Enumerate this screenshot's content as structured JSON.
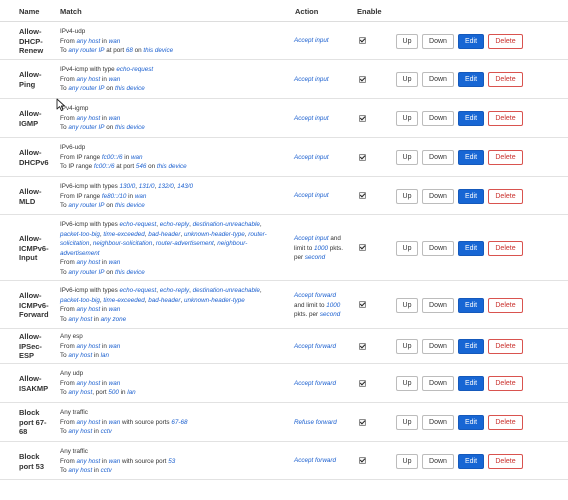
{
  "header": {
    "name": "Name",
    "match": "Match",
    "action": "Action",
    "enable": "Enable"
  },
  "buttons": {
    "up": "Up",
    "down": "Down",
    "edit": "Edit",
    "delete": "Delete"
  },
  "rules": [
    {
      "name": [
        "Allow-",
        "DHCP-",
        "Renew"
      ],
      "match": [
        [
          {
            "t": "IPv4-udp"
          }
        ],
        [
          {
            "t": "From "
          },
          {
            "t": "any host",
            "h": true
          },
          {
            "t": " in "
          },
          {
            "t": "wan",
            "h": true
          }
        ],
        [
          {
            "t": "To "
          },
          {
            "t": "any router IP",
            "h": true
          },
          {
            "t": " at port "
          },
          {
            "t": "68",
            "h": true
          },
          {
            "t": " on "
          },
          {
            "t": "this device",
            "h": true
          }
        ]
      ],
      "action": [
        [
          {
            "t": "Accept input",
            "h": true
          }
        ]
      ],
      "enabled": true
    },
    {
      "name": [
        "Allow-",
        "Ping"
      ],
      "match": [
        [
          {
            "t": "IPv4-icmp with type "
          },
          {
            "t": "echo-request",
            "h": true
          }
        ],
        [
          {
            "t": "From "
          },
          {
            "t": "any host",
            "h": true
          },
          {
            "t": " in "
          },
          {
            "t": "wan",
            "h": true
          }
        ],
        [
          {
            "t": "To "
          },
          {
            "t": "any router IP",
            "h": true
          },
          {
            "t": " on "
          },
          {
            "t": "this device",
            "h": true
          }
        ]
      ],
      "action": [
        [
          {
            "t": "Accept input",
            "h": true
          }
        ]
      ],
      "enabled": true
    },
    {
      "name": [
        "Allow-",
        "IGMP"
      ],
      "match": [
        [
          {
            "t": "IPv4-igmp"
          }
        ],
        [
          {
            "t": "From "
          },
          {
            "t": "any host",
            "h": true
          },
          {
            "t": " in "
          },
          {
            "t": "wan",
            "h": true
          }
        ],
        [
          {
            "t": "To "
          },
          {
            "t": "any router IP",
            "h": true
          },
          {
            "t": " on "
          },
          {
            "t": "this device",
            "h": true
          }
        ]
      ],
      "action": [
        [
          {
            "t": "Accept input",
            "h": true
          }
        ]
      ],
      "enabled": true
    },
    {
      "name": [
        "Allow-",
        "DHCPv6"
      ],
      "match": [
        [
          {
            "t": "IPv6-udp"
          }
        ],
        [
          {
            "t": "From IP range "
          },
          {
            "t": "fc00::/6",
            "h": true
          },
          {
            "t": " in "
          },
          {
            "t": "wan",
            "h": true
          }
        ],
        [
          {
            "t": "To IP range "
          },
          {
            "t": "fc00::/6",
            "h": true
          },
          {
            "t": " at port "
          },
          {
            "t": "546",
            "h": true
          },
          {
            "t": " on "
          },
          {
            "t": "this device",
            "h": true
          }
        ]
      ],
      "action": [
        [
          {
            "t": "Accept input",
            "h": true
          }
        ]
      ],
      "enabled": true
    },
    {
      "name": [
        "Allow-",
        "MLD"
      ],
      "match": [
        [
          {
            "t": "IPv6-icmp with types "
          },
          {
            "t": "130/0",
            "h": true
          },
          {
            "t": ", "
          },
          {
            "t": "131/0",
            "h": true
          },
          {
            "t": ", "
          },
          {
            "t": "132/0",
            "h": true
          },
          {
            "t": ", "
          },
          {
            "t": "143/0",
            "h": true
          }
        ],
        [
          {
            "t": "From IP range "
          },
          {
            "t": "fe80::/10",
            "h": true
          },
          {
            "t": " in "
          },
          {
            "t": "wan",
            "h": true
          }
        ],
        [
          {
            "t": "To "
          },
          {
            "t": "any router IP",
            "h": true
          },
          {
            "t": " on "
          },
          {
            "t": "this device",
            "h": true
          }
        ]
      ],
      "action": [
        [
          {
            "t": "Accept input",
            "h": true
          }
        ]
      ],
      "enabled": true
    },
    {
      "name": [
        "Allow-",
        "ICMPv6-",
        "Input"
      ],
      "match": [
        [
          {
            "t": "IPv6-icmp with types "
          },
          {
            "t": "echo-request",
            "h": true
          },
          {
            "t": ", "
          },
          {
            "t": "echo-reply",
            "h": true
          },
          {
            "t": ", "
          },
          {
            "t": "destination-unreachable",
            "h": true
          },
          {
            "t": ","
          }
        ],
        [
          {
            "t": "packet-too-big",
            "h": true
          },
          {
            "t": ", "
          },
          {
            "t": "time-exceeded",
            "h": true
          },
          {
            "t": ", "
          },
          {
            "t": "bad-header",
            "h": true
          },
          {
            "t": ", "
          },
          {
            "t": "unknown-header-type",
            "h": true
          },
          {
            "t": ", "
          },
          {
            "t": "router-",
            "h": true
          }
        ],
        [
          {
            "t": "solicitation",
            "h": true
          },
          {
            "t": ", "
          },
          {
            "t": "neighbour-solicitation",
            "h": true
          },
          {
            "t": ", "
          },
          {
            "t": "router-advertisement",
            "h": true
          },
          {
            "t": ", "
          },
          {
            "t": "neighbour-",
            "h": true
          }
        ],
        [
          {
            "t": "advertisement",
            "h": true
          }
        ],
        [
          {
            "t": "From "
          },
          {
            "t": "any host",
            "h": true
          },
          {
            "t": " in "
          },
          {
            "t": "wan",
            "h": true
          }
        ],
        [
          {
            "t": "To "
          },
          {
            "t": "any router IP",
            "h": true
          },
          {
            "t": " on "
          },
          {
            "t": "this device",
            "h": true
          }
        ]
      ],
      "action": [
        [
          {
            "t": "Accept input",
            "h": true
          },
          {
            "t": " and"
          }
        ],
        [
          {
            "t": "limit to "
          },
          {
            "t": "1000",
            "h": true
          },
          {
            "t": " pkts."
          }
        ],
        [
          {
            "t": "per "
          },
          {
            "t": "second",
            "h": true
          }
        ]
      ],
      "enabled": true
    },
    {
      "name": [
        "Allow-",
        "ICMPv6-",
        "Forward"
      ],
      "match": [
        [
          {
            "t": "IPv6-icmp with types "
          },
          {
            "t": "echo-request",
            "h": true
          },
          {
            "t": ", "
          },
          {
            "t": "echo-reply",
            "h": true
          },
          {
            "t": ", "
          },
          {
            "t": "destination-unreachable",
            "h": true
          },
          {
            "t": ","
          }
        ],
        [
          {
            "t": "packet-too-big",
            "h": true
          },
          {
            "t": ", "
          },
          {
            "t": "time-exceeded",
            "h": true
          },
          {
            "t": ", "
          },
          {
            "t": "bad-header",
            "h": true
          },
          {
            "t": ", "
          },
          {
            "t": "unknown-header-type",
            "h": true
          }
        ],
        [
          {
            "t": "From "
          },
          {
            "t": "any host",
            "h": true
          },
          {
            "t": " in "
          },
          {
            "t": "wan",
            "h": true
          }
        ],
        [
          {
            "t": "To "
          },
          {
            "t": "any host",
            "h": true
          },
          {
            "t": " in "
          },
          {
            "t": "any zone",
            "h": true
          }
        ]
      ],
      "action": [
        [
          {
            "t": "Accept forward",
            "h": true
          }
        ],
        [
          {
            "t": "and limit to "
          },
          {
            "t": "1000",
            "h": true
          }
        ],
        [
          {
            "t": "pkts. per "
          },
          {
            "t": "second",
            "h": true
          }
        ]
      ],
      "enabled": true
    },
    {
      "name": [
        "Allow-",
        "IPSec-",
        "ESP"
      ],
      "match": [
        [
          {
            "t": "Any esp"
          }
        ],
        [
          {
            "t": "From "
          },
          {
            "t": "any host",
            "h": true
          },
          {
            "t": " in "
          },
          {
            "t": "wan",
            "h": true
          }
        ],
        [
          {
            "t": "To "
          },
          {
            "t": "any host",
            "h": true
          },
          {
            "t": " in "
          },
          {
            "t": "lan",
            "h": true
          }
        ]
      ],
      "action": [
        [
          {
            "t": "Accept forward",
            "h": true
          }
        ]
      ],
      "enabled": true
    },
    {
      "name": [
        "Allow-",
        "ISAKMP"
      ],
      "match": [
        [
          {
            "t": "Any udp"
          }
        ],
        [
          {
            "t": "From "
          },
          {
            "t": "any host",
            "h": true
          },
          {
            "t": " in "
          },
          {
            "t": "wan",
            "h": true
          }
        ],
        [
          {
            "t": "To "
          },
          {
            "t": "any host",
            "h": true
          },
          {
            "t": ", port "
          },
          {
            "t": "500",
            "h": true
          },
          {
            "t": " in "
          },
          {
            "t": "lan",
            "h": true
          }
        ]
      ],
      "action": [
        [
          {
            "t": "Accept forward",
            "h": true
          }
        ]
      ],
      "enabled": true
    },
    {
      "name": [
        "Block",
        "port 67-",
        "68"
      ],
      "match": [
        [
          {
            "t": "Any traffic"
          }
        ],
        [
          {
            "t": "From "
          },
          {
            "t": "any host",
            "h": true
          },
          {
            "t": " in "
          },
          {
            "t": "wan",
            "h": true
          },
          {
            "t": " with source ports "
          },
          {
            "t": "67-68",
            "h": true
          }
        ],
        [
          {
            "t": "To "
          },
          {
            "t": "any host",
            "h": true
          },
          {
            "t": " in "
          },
          {
            "t": "cctv",
            "h": true
          }
        ]
      ],
      "action": [
        [
          {
            "t": "Refuse forward",
            "h": true
          }
        ]
      ],
      "enabled": true
    },
    {
      "name": [
        "Block",
        "port 53"
      ],
      "match": [
        [
          {
            "t": "Any traffic"
          }
        ],
        [
          {
            "t": "From "
          },
          {
            "t": "any host",
            "h": true
          },
          {
            "t": " in "
          },
          {
            "t": "wan",
            "h": true
          },
          {
            "t": " with source port "
          },
          {
            "t": "53",
            "h": true
          }
        ],
        [
          {
            "t": "To "
          },
          {
            "t": "any host",
            "h": true
          },
          {
            "t": " in "
          },
          {
            "t": "cctv",
            "h": true
          }
        ]
      ],
      "action": [
        [
          {
            "t": "Accept forward",
            "h": true
          }
        ]
      ],
      "enabled": true
    }
  ]
}
